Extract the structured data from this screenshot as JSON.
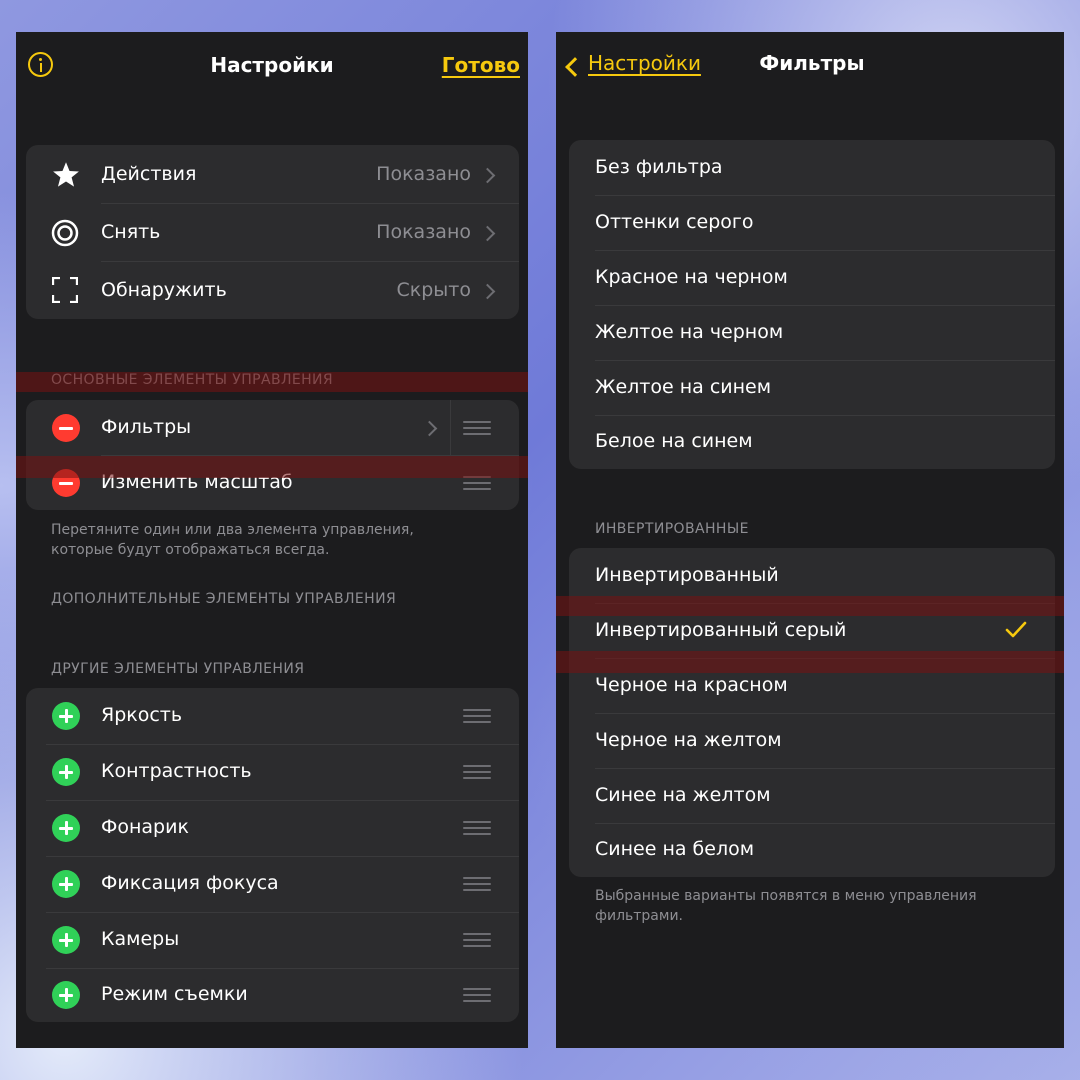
{
  "settings": {
    "nav": {
      "title": "Настройки",
      "done": "Готово",
      "info_icon": "info-circle-icon"
    },
    "modes": [
      {
        "label": "Действия",
        "value": "Показано",
        "icon": "star-icon"
      },
      {
        "label": "Снять",
        "value": "Показано",
        "icon": "capture-circle-icon"
      },
      {
        "label": "Обнаружить",
        "value": "Скрыто",
        "icon": "detect-frame-icon"
      }
    ],
    "main_controls": {
      "header": "ОСНОВНЫЕ ЭЛЕМЕНТЫ УПРАВЛЕНИЯ",
      "items": [
        {
          "label": "Фильтры"
        },
        {
          "label": "Изменить масштаб"
        }
      ],
      "footer": "Перетяните один или два элемента управления, которые будут отображаться всегда."
    },
    "additional_controls": {
      "header": "ДОПОЛНИТЕЛЬНЫЕ ЭЛЕМЕНТЫ УПРАВЛЕНИЯ"
    },
    "other_controls": {
      "header": "ДРУГИЕ ЭЛЕМЕНТЫ УПРАВЛЕНИЯ",
      "items": [
        {
          "label": "Яркость"
        },
        {
          "label": "Контрастность"
        },
        {
          "label": "Фонарик"
        },
        {
          "label": "Фиксация фокуса"
        },
        {
          "label": "Камеры"
        },
        {
          "label": "Режим съемки"
        }
      ]
    }
  },
  "filters": {
    "nav": {
      "back": "Настройки",
      "title": "Фильтры"
    },
    "basic": [
      "Без фильтра",
      "Оттенки серого",
      "Красное на черном",
      "Желтое на черном",
      "Желтое на синем",
      "Белое на синем"
    ],
    "inverted_header": "ИНВЕРТИРОВАННЫЕ",
    "inverted": [
      "Инвертированный",
      "Инвертированный серый",
      "Черное на красном",
      "Черное на желтом",
      "Синее на желтом",
      "Синее на белом"
    ],
    "selected": "Инвертированный серый",
    "footer": "Выбранные варианты появятся в меню управления фильтрами."
  },
  "colors": {
    "accent": "#f6c90e",
    "remove": "#ff3b30",
    "add": "#30d158",
    "background": "#1c1c1e",
    "cell": "#2c2c2e",
    "highlight": "#781212"
  }
}
